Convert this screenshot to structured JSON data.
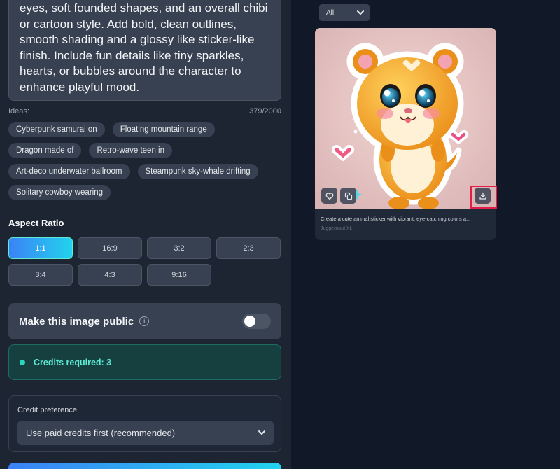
{
  "prompt": {
    "text": "eyes, soft founded shapes, and an overall chibi or cartoon style. Add bold, clean outlines, smooth shading and a glossy like sticker-like finish. Include fun details like tiny sparkles, hearts, or bubbles around the character to enhance playful mood."
  },
  "ideas": {
    "label": "Ideas:",
    "counter": "379/2000",
    "items": [
      "Cyberpunk samurai on",
      "Floating mountain range",
      "Dragon made of",
      "Retro-wave teen in",
      "Art-deco underwater ballroom",
      "Steampunk sky-whale drifting",
      "Solitary cowboy wearing"
    ]
  },
  "aspect_ratio": {
    "title": "Aspect Ratio",
    "options": [
      "1:1",
      "16:9",
      "3:2",
      "2:3",
      "3:4",
      "4:3",
      "9:16"
    ],
    "selected": "1:1"
  },
  "public": {
    "label": "Make this image public",
    "info_icon": "info-icon",
    "enabled": false
  },
  "credits": {
    "text": "Credits required: 3"
  },
  "preference": {
    "label": "Credit preference",
    "value": "Use paid credits first (recommended)"
  },
  "gallery": {
    "filter_value": "All",
    "card": {
      "caption": "Create a cute animal sticker with vibrant, eye-catching colors a...",
      "model": "Juggernaut XL",
      "image_subject": "cute hamster sticker"
    }
  },
  "colors": {
    "accent_start": "#3b82f6",
    "accent_end": "#22d3ee",
    "credits_text": "#5eead4",
    "highlight": "#e11d48"
  }
}
